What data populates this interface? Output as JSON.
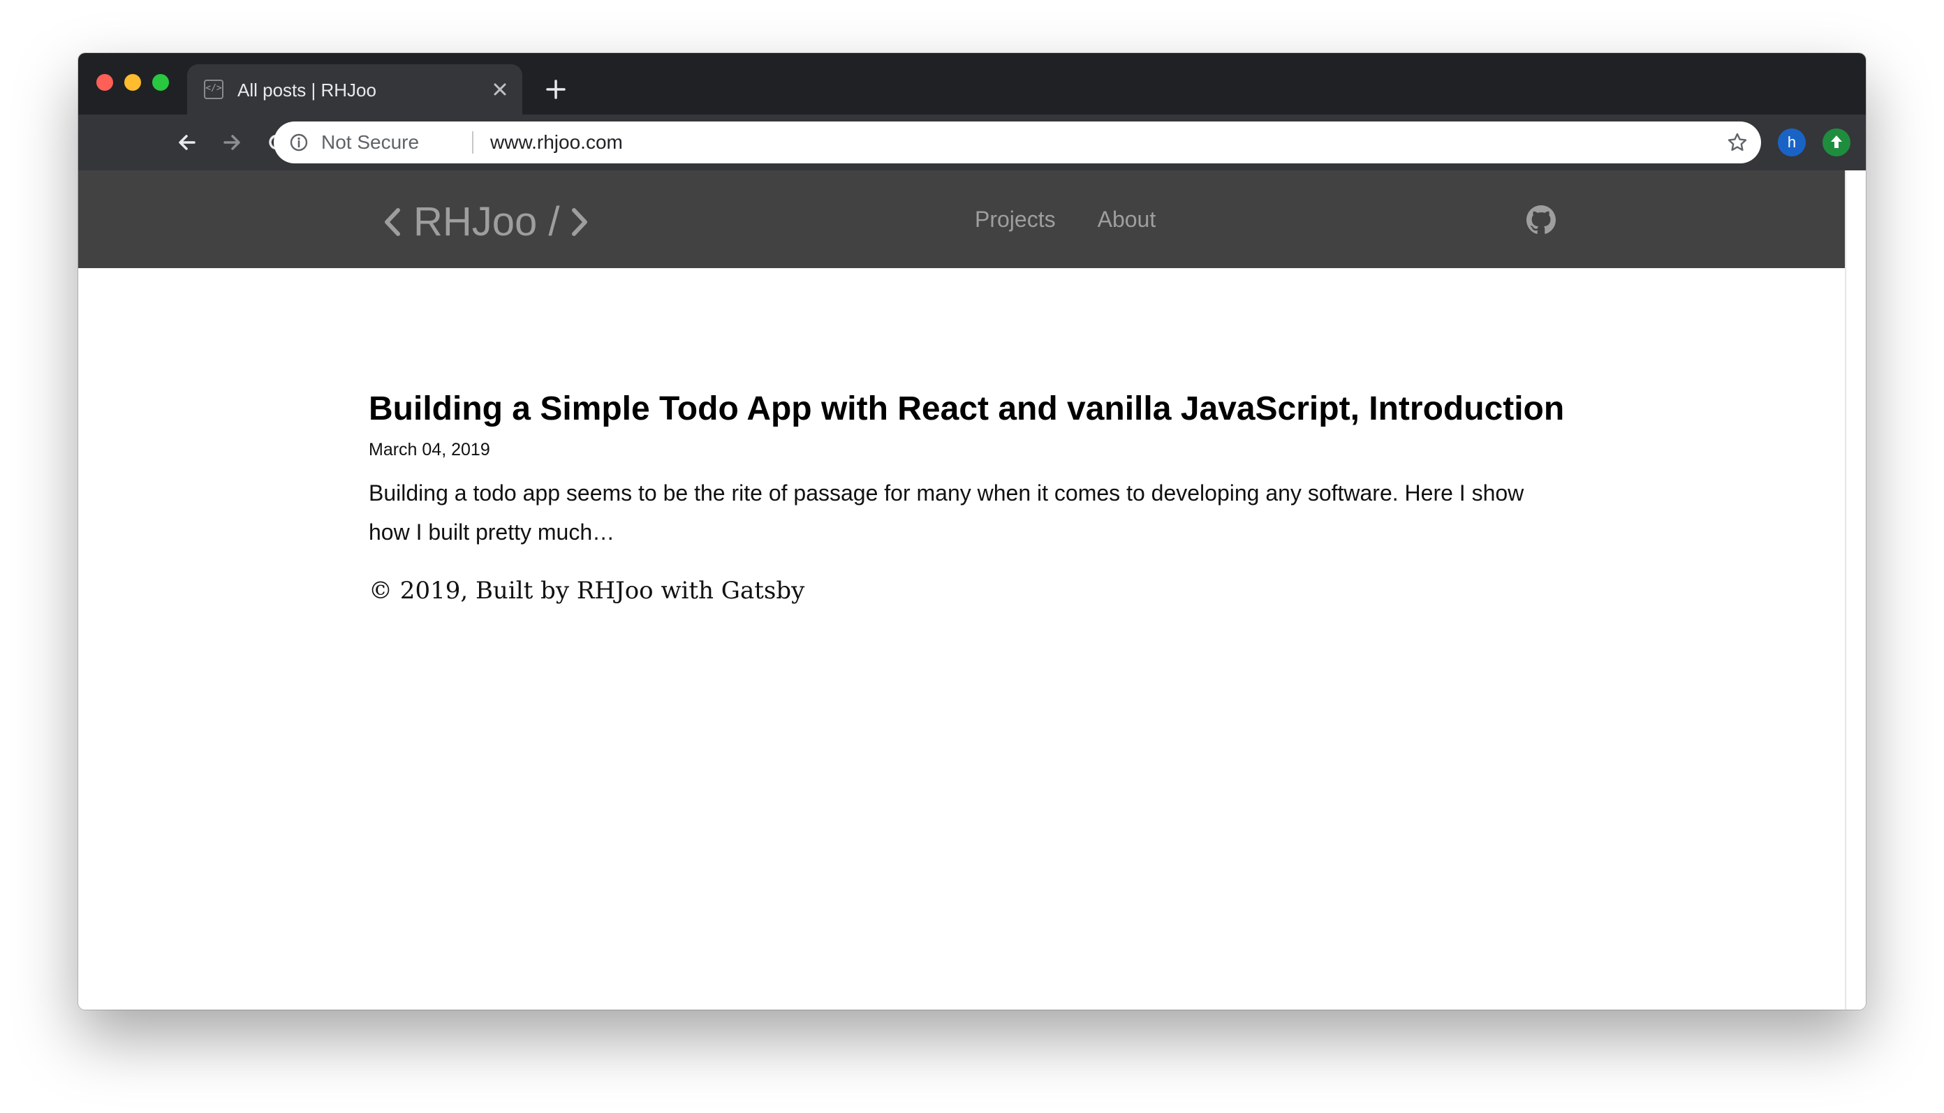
{
  "browser": {
    "tab_title": "All posts | RHJoo",
    "tab_favicon": "</>",
    "omnibox": {
      "security_label": "Not Secure",
      "url": "www.rhjoo.com"
    },
    "profile_initial": "h"
  },
  "icons": {
    "back": "arrow-left-icon",
    "forward": "arrow-right-icon",
    "reload": "reload-icon",
    "home": "home-icon",
    "info": "info-icon",
    "star": "star-icon",
    "close_tab": "close-icon",
    "new_tab": "plus-icon",
    "github": "github-icon",
    "extension": "upload-arrow-icon"
  },
  "site": {
    "logo_text": "RHJoo /",
    "nav": [
      {
        "label": "Projects"
      },
      {
        "label": "About"
      }
    ]
  },
  "post": {
    "title": "Building a Simple Todo App with React and vanilla JavaScript, Introduction",
    "date": "March 04, 2019",
    "excerpt": "Building a todo app seems to be the rite of passage for many when it comes to developing any software. Here I show how I built pretty much…"
  },
  "footer": {
    "text": "© 2019, Built by RHJoo with Gatsby"
  },
  "colors": {
    "titlebar": "#202124",
    "toolbar": "#35363a",
    "site_header": "#424242",
    "nav_text": "#9e9e9e"
  }
}
